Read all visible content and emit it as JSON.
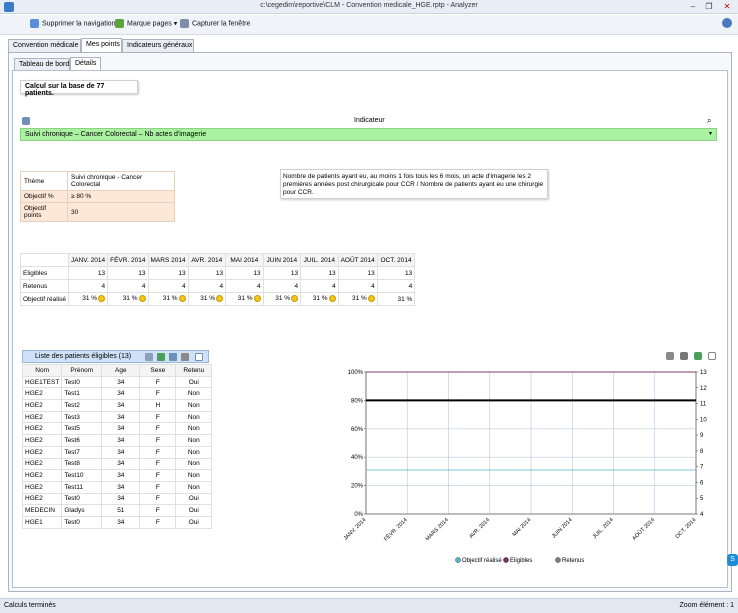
{
  "window": {
    "title": "c:\\cegedim\\reportive\\CLM - Convention medicale_HGE.rptp - Analyzer",
    "minimize": "–",
    "restore": "❐",
    "close": "✕"
  },
  "menu": {
    "remove_nav": "Supprimer la navigation",
    "bookmarks": "Marque pages",
    "capture": "Capturer la fenêtre"
  },
  "tabs": {
    "outer": [
      "Convention médicale",
      "Mes points",
      "Indicateurs généraux"
    ],
    "outer_active": 1,
    "inner": [
      "Tableau de bord",
      "Détails"
    ],
    "inner_active": 1
  },
  "calc_label": "Calcul sur la base de 77 patients.",
  "indicator": {
    "label": "Indicateur",
    "selected": "Suivi chronique – Cancer Colorectal – Nb actes d'imagerie"
  },
  "theme": {
    "rows": [
      {
        "key": "Thème",
        "value": "Suivi chronique - Cancer Colorectal"
      },
      {
        "key": "Objectif %",
        "value": "≥ 80 %"
      },
      {
        "key": "Objectif points",
        "value": "30"
      }
    ],
    "description": "Nombre de patients ayant eu, au moins 1 fois tous les 6 mois, un acte d'imagerie les 2 premières années post chirurgicale pour CCR / Nombre de patients ayant eu une chirurgie pour CCR."
  },
  "monthly": {
    "months": [
      "JANV. 2014",
      "FÉVR. 2014",
      "MARS 2014",
      "AVR. 2014",
      "MAI 2014",
      "JUIN 2014",
      "JUIL. 2014",
      "AOÛT 2014",
      "OCT. 2014"
    ],
    "rows": [
      {
        "label": "Eligibles",
        "values": [
          "13",
          "13",
          "13",
          "13",
          "13",
          "13",
          "13",
          "13",
          "13"
        ]
      },
      {
        "label": "Retenus",
        "values": [
          "4",
          "4",
          "4",
          "4",
          "4",
          "4",
          "4",
          "4",
          "4"
        ]
      },
      {
        "label": "Objectif réalisé",
        "values": [
          "31 %",
          "31 %",
          "31 %",
          "31 %",
          "31 %",
          "31 %",
          "31 %",
          "31 %",
          "31 %"
        ]
      }
    ]
  },
  "patients": {
    "title": "Liste des patients éligibles (13)",
    "headers": [
      "Nom",
      "Prénom",
      "Age",
      "Sexe",
      "Retenu"
    ],
    "rows": [
      [
        "HGE1TEST",
        "Test0",
        "34",
        "F",
        "Oui"
      ],
      [
        "HGE2",
        "Test1",
        "34",
        "F",
        "Non"
      ],
      [
        "HGE2",
        "Test2",
        "34",
        "H",
        "Non"
      ],
      [
        "HGE2",
        "Test3",
        "34",
        "F",
        "Non"
      ],
      [
        "HGE2",
        "Test5",
        "34",
        "F",
        "Non"
      ],
      [
        "HGE2",
        "Test6",
        "34",
        "F",
        "Non"
      ],
      [
        "HGE2",
        "Test7",
        "34",
        "F",
        "Non"
      ],
      [
        "HGE2",
        "Test8",
        "34",
        "F",
        "Non"
      ],
      [
        "HGE2",
        "Test10",
        "34",
        "F",
        "Non"
      ],
      [
        "HGE2",
        "Test11",
        "34",
        "F",
        "Non"
      ],
      [
        "HGE2",
        "Test0",
        "34",
        "F",
        "Oui"
      ],
      [
        "MEDECIN",
        "Gladys",
        "51",
        "F",
        "Oui"
      ],
      [
        "HGE1",
        "Test0",
        "34",
        "F",
        "Oui"
      ]
    ]
  },
  "chart_data": {
    "type": "line",
    "x": [
      "JANV. 2014",
      "FÉVR. 2014",
      "MARS 2014",
      "AVR. 2014",
      "MAI 2014",
      "JUIN 2014",
      "JUIL. 2014",
      "AOÛT 2014",
      "OCT. 2014"
    ],
    "left_ticks": [
      "0%",
      "20%",
      "40%",
      "60%",
      "80%",
      "100%"
    ],
    "right_ticks": [
      "4",
      "5",
      "6",
      "7",
      "8",
      "9",
      "10",
      "11",
      "12",
      "13"
    ],
    "left_range": [
      0,
      100
    ],
    "right_range": [
      4,
      13
    ],
    "series": [
      {
        "name": "Objectif réalisé",
        "axis": "left",
        "values": [
          31,
          31,
          31,
          31,
          31,
          31,
          31,
          31,
          31
        ],
        "color": "#4bb9c9"
      },
      {
        "name": "Eligibles",
        "axis": "right",
        "values": [
          13,
          13,
          13,
          13,
          13,
          13,
          13,
          13,
          13
        ],
        "color": "#7a2b6e"
      },
      {
        "name": "Retenus",
        "axis": "right",
        "values": [
          4,
          4,
          4,
          4,
          4,
          4,
          4,
          4,
          4
        ],
        "color": "#7d7d7d"
      }
    ],
    "objective_line": {
      "value": 80,
      "axis": "left",
      "color": "#000000"
    },
    "grid": true,
    "legend_position": "bottom"
  },
  "status": {
    "left": "Calculs terminés",
    "right": "Zoom élément : 1"
  },
  "colors": {
    "indicator_bar": "#a9f2a0",
    "objective_bg": "#fde8d8",
    "list_header": "#cfe1f6"
  }
}
